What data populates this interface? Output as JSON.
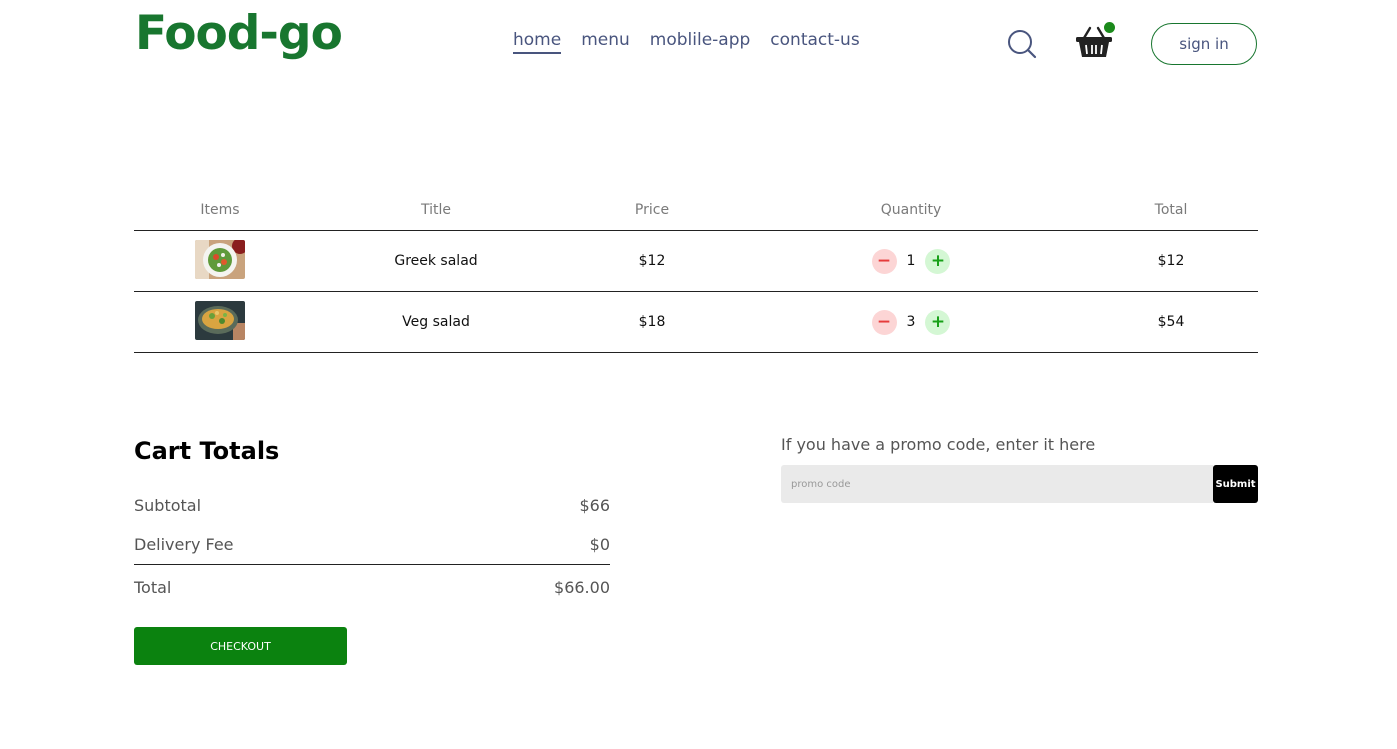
{
  "header": {
    "logo": "Food-go",
    "nav": [
      "home",
      "menu",
      "moblile-app",
      "contact-us"
    ],
    "active_nav": "home",
    "search_icon": "search-icon",
    "cart_icon": "basket-icon",
    "signin_label": "sign in"
  },
  "cart": {
    "columns": [
      "Items",
      "Title",
      "Price",
      "Quantity",
      "Total"
    ],
    "rows": [
      {
        "image": "greek-salad-image",
        "title": "Greek salad",
        "price": "$12",
        "quantity": "1",
        "total": "$12"
      },
      {
        "image": "veg-salad-image",
        "title": "Veg salad",
        "price": "$18",
        "quantity": "3",
        "total": "$54"
      }
    ],
    "minus_symbol": "−",
    "plus_symbol": "+"
  },
  "totals": {
    "title": "Cart Totals",
    "subtotal_label": "Subtotal",
    "subtotal_value": "$66",
    "delivery_label": "Delivery Fee",
    "delivery_value": "$0",
    "total_label": "Total",
    "total_value": "$66.00",
    "checkout_label": "CHECKOUT"
  },
  "promo": {
    "text": "If you have a promo code, enter it here",
    "placeholder": "promo code",
    "submit_label": "Submit"
  },
  "colors": {
    "brand": "#18762f",
    "checkout": "#0b820f",
    "nav_text": "#49557e",
    "minus_bg": "#fcd5d5",
    "plus_bg": "#d4f7d4"
  }
}
